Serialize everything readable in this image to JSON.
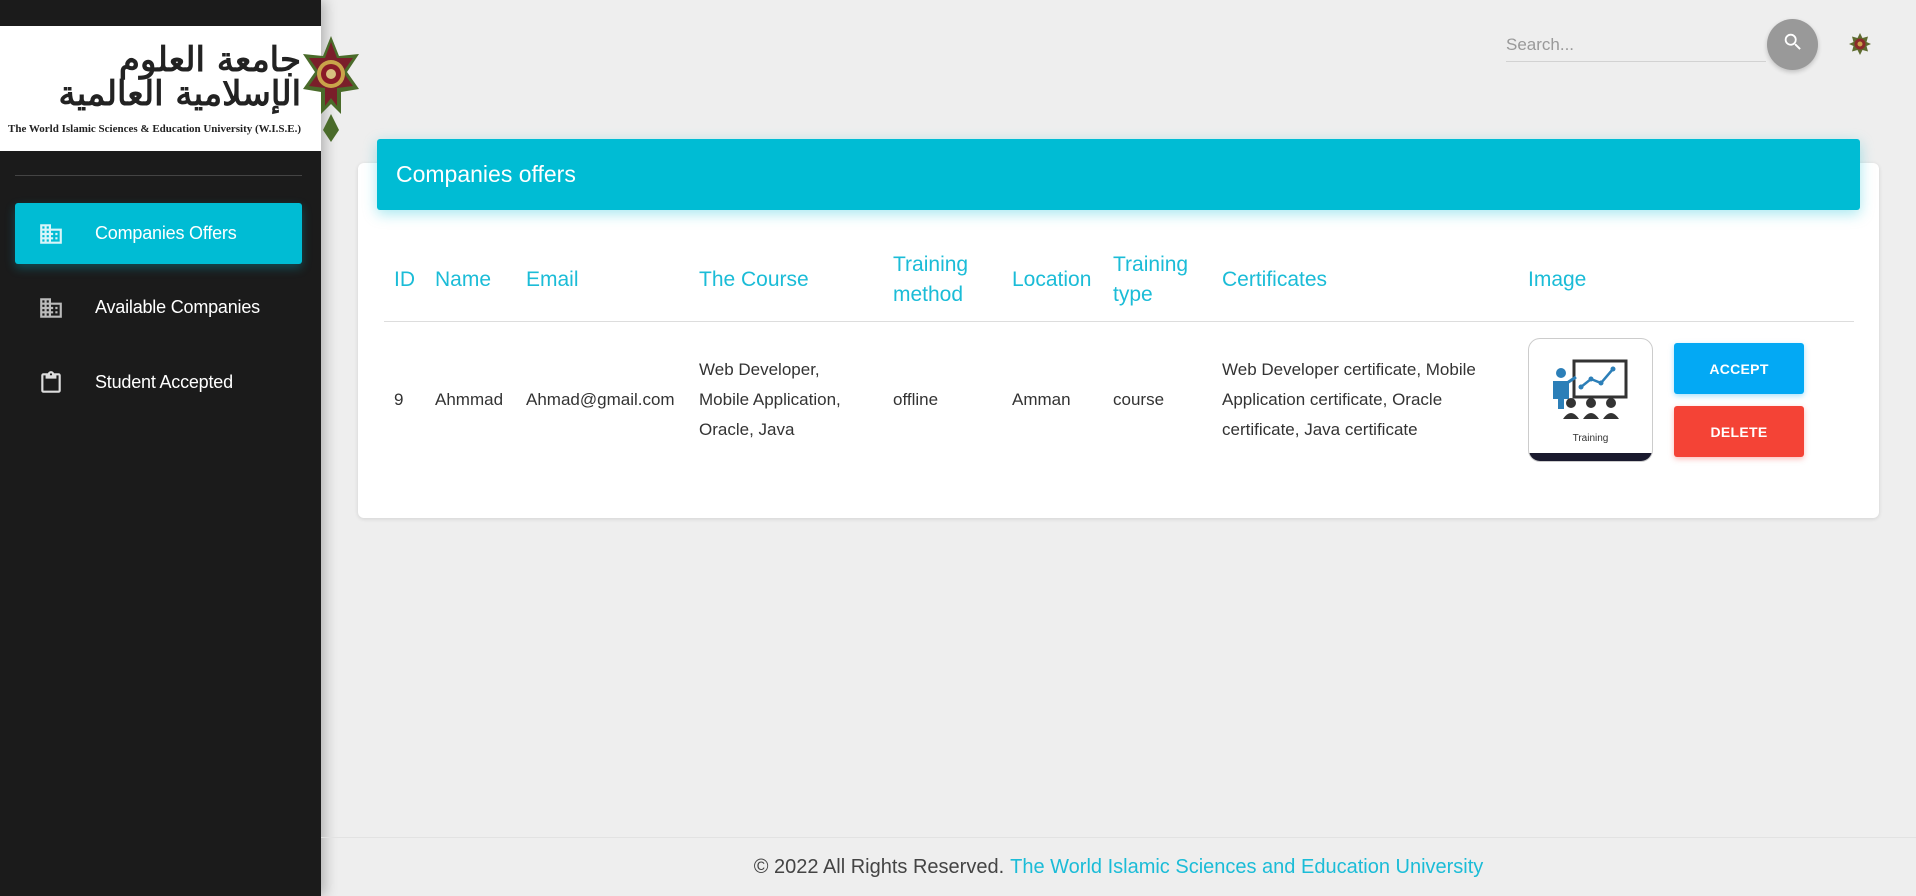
{
  "sidebar": {
    "logo": {
      "arabic_text": "جامعة العلوم الإسلامية العالمية",
      "english_text": "The World Islamic Sciences & Education University (W.I.S.E.)"
    },
    "items": [
      {
        "label": "Companies Offers",
        "icon": "building-icon",
        "active": true
      },
      {
        "label": "Available Companies",
        "icon": "building-icon",
        "active": false
      },
      {
        "label": "Student Accepted",
        "icon": "clipboard-icon",
        "active": false
      }
    ]
  },
  "header": {
    "search_placeholder": "Search...",
    "search_icon": "search-icon",
    "settings_icon": "seal-icon"
  },
  "card": {
    "title": "Companies offers",
    "columns": [
      "ID",
      "Name",
      "Email",
      "The Course",
      "Training method",
      "Location",
      "Training type",
      "Certificates",
      "Image"
    ],
    "rows": [
      {
        "id": "9",
        "name": "Ahmmad",
        "email": "Ahmad@gmail.com",
        "course": "Web Developer, Mobile Application, Oracle, Java",
        "training_method": "offline",
        "location": "Amman",
        "training_type": "course",
        "certificates": "Web Developer certificate, Mobile Application certificate, Oracle certificate, Java certificate",
        "image_caption": "Training",
        "accept_label": "ACCEPT",
        "delete_label": "DELETE"
      }
    ]
  },
  "footer": {
    "text": "© 2022 All Rights Reserved.",
    "link": "The World Islamic Sciences and Education University"
  },
  "colors": {
    "accent": "#00bcd4",
    "accept": "#03a9f4",
    "delete": "#f44336",
    "sidebar_bg": "#1b1b1b",
    "page_bg": "#eeeeee"
  }
}
